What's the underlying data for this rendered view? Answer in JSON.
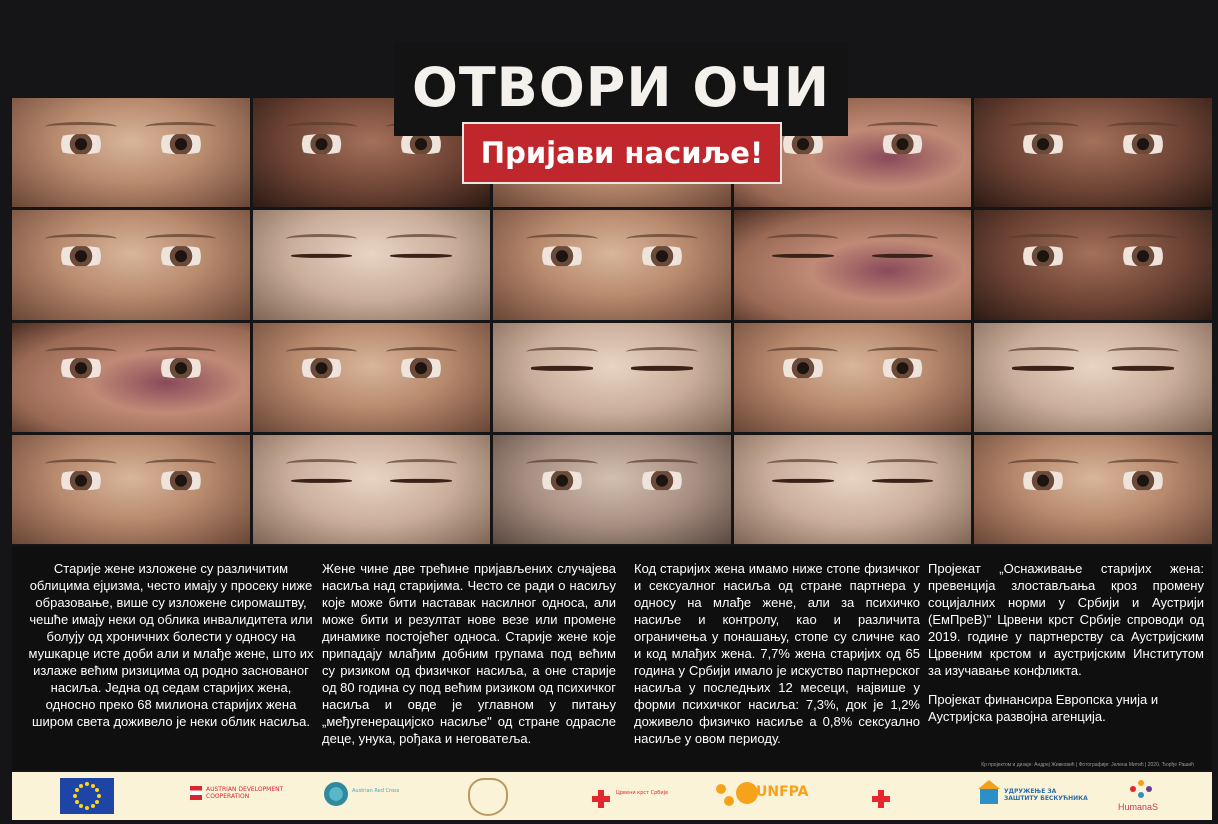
{
  "title": "ОТВОРИ ОЧИ",
  "subtitle": "Пријави насиље!",
  "columns": [
    "Старије жене изложене су различитим облицима ејџизма, често имају у просеку ниже образовање, више су изложене сиромаштву, чешће имају неки од облика инвалидитета или болују од хроничних болести у односу на мушкарце исте доби али и млађе жене, што их излаже већим ризицима од родно заснованог насиља. Једна од седам старијих жена, односно преко 68 милиона старијих жена широм света доживело је неки облик насиља.",
    "Жене чине две трећине пријављених случајева насиља над старијима. Често се ради о насиљу које може бити наставак насилног односа, али може бити и резултат нове везе или промене динамике постојећег односа. Старије жене које припадају млађим добним групама под већим су ризиком од физичког насиља, а оне старије од 80 година су под већим ризиком од психичког насиља и овде је углавном у питању „међугенерацијско насиље\" од стране одрасле деце, унука, рођака и неговатеља.",
    "Код старијих жена имамо ниже стопе физичког и сексуалног насиља од стране партнера у односу на млађе жене, али за психичко насиље и контролу, као и различита ограничења у понашању, стопе су сличне као и код млађих жена.   7,7% жена старијих од 65 година у Србији имало је искуство партнерског насиља у последњих 12 месеци, највише у форми психичког насиља: 7,3%, док је 1,2% доживело физичко насиље а 0,8% сексуално насиље у овом периоду."
  ],
  "project": {
    "paragraph1": "Пројекат „Оснаживање старијих жена: превенција злостављања кроз промену социјалних норми у Србији и Аустрији (ЕмПреВ)\" Црвени крст Србије спроводи од 2019. године у партнерству са Аустријским Црвеним крстом и аустријским Институтом за изучавање конфликта.",
    "paragraph2": "Пројекат финансира Европска унија и Аустријска развојна агенција."
  },
  "credit": "Кр пројектом и дизајн: Андреј Живковић  |  Фотографије: Јелена Митић  |  2020. Ђорђе Рашић",
  "logos": {
    "ada_text": "AUSTRIAN DEVELOPMENT COOPERATION",
    "circle_text": "Austrian Red Cross",
    "rc1_text": "Црвени крст Србије",
    "unfpa_text": "UNFPA",
    "zastita_text": "УДРУЖЕЊЕ ЗА ЗАШТИТУ БЕСКУЋНИКА",
    "humanas_text": "HumanaS"
  },
  "colors": {
    "title_bg": "#131313",
    "subtitle_bg": "#c0272d",
    "logo_strip_bg": "#fbf3d8"
  },
  "photos": [
    "eyes-open",
    "eyes-dark",
    "eyes-open",
    "eyes-bruise",
    "eyes-dark",
    "eyes-open",
    "eyes-squint",
    "eyes-open",
    "eyes-bruise-closed",
    "eyes-dark",
    "eyes-bruise",
    "eyes-open",
    "eyes-closed",
    "eyes-open",
    "eyes-closed",
    "eyes-open",
    "eyes-closed",
    "eyes-cut",
    "eyes-swollen",
    "eyes-open"
  ]
}
